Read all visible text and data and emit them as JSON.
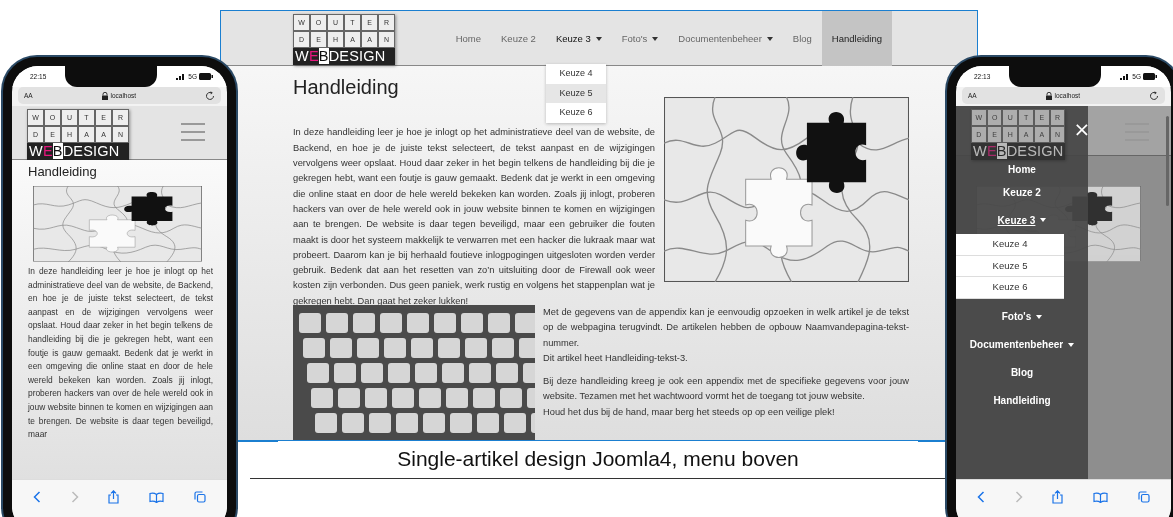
{
  "desktop": {
    "logo": {
      "tile_rows": [
        [
          "W",
          "O",
          "U",
          "T",
          "E",
          "R"
        ],
        [
          "D",
          "E",
          "H",
          "A",
          "A",
          "N"
        ]
      ],
      "wordmark": [
        {
          "text": "W",
          "kind": "plain"
        },
        {
          "text": "E",
          "kind": "accent"
        },
        {
          "text": "B",
          "kind": "boxed"
        },
        {
          "text": "DESIGN",
          "kind": "plain"
        }
      ]
    },
    "nav": [
      {
        "label": "Home",
        "has_submenu": false,
        "expanded": false,
        "selected": false
      },
      {
        "label": "Keuze 2",
        "has_submenu": false,
        "expanded": false,
        "selected": false
      },
      {
        "label": "Keuze 3",
        "has_submenu": true,
        "expanded": true,
        "selected": false,
        "children": [
          {
            "label": "Keuze 4",
            "highlighted": false
          },
          {
            "label": "Keuze 5",
            "highlighted": true
          },
          {
            "label": "Keuze 6",
            "highlighted": false
          }
        ]
      },
      {
        "label": "Foto's",
        "has_submenu": true,
        "expanded": false,
        "selected": false
      },
      {
        "label": "Documentenbeheer",
        "has_submenu": true,
        "expanded": false,
        "selected": false
      },
      {
        "label": "Blog",
        "has_submenu": false,
        "expanded": false,
        "selected": false
      },
      {
        "label": "Handleiding",
        "has_submenu": false,
        "expanded": false,
        "selected": true
      }
    ],
    "title": "Handleiding",
    "intro": "In deze handleiding leer je hoe je inlogt op het administratieve deel van de website, de Backend, en hoe je de juiste tekst selecteert, de tekst aanpast en de wijzigingen vervolgens weer opslaat. Houd daar zeker in het begin telkens de handleiding bij die je gekregen hebt, want een foutje is gauw gemaakt. Bedenk dat je werkt in een omgeving die online staat en door de hele wereld bekeken kan worden. Zoals jij inlogt, proberen hackers van over de hele wereld ook in jouw website binnen te komen en wijzigingen aan te brengen. De website is daar tegen beveiligd, maar een gebruiker die fouten maakt is door het systeem makkelijk te verwarren met een hacker die lukraak maar wat probeert. Daarom kan je bij herhaald foutieve inlogpogingen uitgesloten worden verder gebruik. Bedenk dat aan het resetten van zo’n uitsluiting door de Firewall ook weer kosten zijn verbonden. Dus geen paniek, werk rustig en volgens het stappenplan wat je gekregen hebt. Dan gaat het zeker lukken!",
    "paragraphs": [
      [
        "Met de gegevens van de appendix kan je eenvoudig opzoeken in welk artikel je de tekst op de webpagina terugvindt. De artikelen hebben de opbouw Naamvandepagina-tekst-nummer.",
        "Dit artikel heet Handleiding-tekst-3."
      ],
      [
        "Bij deze handleiding kreeg je ook een appendix met de specifieke gegevens voor jouw website. Tezamen met het wachtwoord vormt het de toegang tot jouw website.",
        "Houd het dus bij de hand, maar berg het steeds op op een veilige plek!"
      ]
    ]
  },
  "caption": "Single-artikel design Joomla4, menu boven",
  "phone_left": {
    "time": "22:15",
    "network": "5G",
    "text_size": "AA",
    "address": "localhost",
    "logo": {
      "tile_rows": [
        [
          "W",
          "O",
          "U",
          "T",
          "E",
          "R"
        ],
        [
          "D",
          "E",
          "H",
          "A",
          "A",
          "N"
        ]
      ],
      "wordmark": [
        {
          "text": "W",
          "kind": "plain"
        },
        {
          "text": "E",
          "kind": "accent"
        },
        {
          "text": "B",
          "kind": "boxed"
        },
        {
          "text": "DESIGN",
          "kind": "plain"
        }
      ]
    },
    "title": "Handleiding",
    "text": "In deze handleiding leer je hoe je inlogt op het administratieve deel van de website, de Backend, en hoe je de juiste tekst selecteert, de tekst aanpast en de wijzigingen vervolgens weer opslaat. Houd daar zeker in het begin telkens de handleiding bij die je gekregen hebt, want een foutje is gauw gemaakt. Bedenk dat je werkt in een omgeving die online staat en door de hele wereld bekeken kan worden. Zoals jij inlogt, proberen hackers van over de hele wereld ook in jouw website binnen te komen en wijzigingen aan te brengen. De website is daar tegen beveiligd, maar"
  },
  "phone_right": {
    "time": "22:13",
    "network": "5G",
    "text_size": "AA",
    "address": "localhost",
    "logo": {
      "tile_rows": [
        [
          "W",
          "O",
          "U",
          "T",
          "E",
          "R"
        ],
        [
          "D",
          "E",
          "H",
          "A",
          "A",
          "N"
        ]
      ],
      "wordmark": [
        {
          "text": "W",
          "kind": "plain"
        },
        {
          "text": "E",
          "kind": "accent"
        },
        {
          "text": "B",
          "kind": "boxed"
        },
        {
          "text": "DESIGN",
          "kind": "plain"
        }
      ]
    },
    "close": "×",
    "menu": [
      {
        "label": "Home",
        "has_submenu": false,
        "expanded": false
      },
      {
        "label": "Keuze 2",
        "has_submenu": false,
        "expanded": false
      },
      {
        "label": "Keuze 3",
        "has_submenu": true,
        "expanded": true,
        "children": [
          {
            "label": "Keuze 4"
          },
          {
            "label": "Keuze 5"
          },
          {
            "label": "Keuze 6"
          }
        ]
      },
      {
        "label": "Foto's",
        "has_submenu": true,
        "expanded": false
      },
      {
        "label": "Documentenbeheer",
        "has_submenu": true,
        "expanded": false
      },
      {
        "label": "Blog",
        "has_submenu": false,
        "expanded": false
      },
      {
        "label": "Handleiding",
        "has_submenu": false,
        "expanded": false
      }
    ]
  }
}
